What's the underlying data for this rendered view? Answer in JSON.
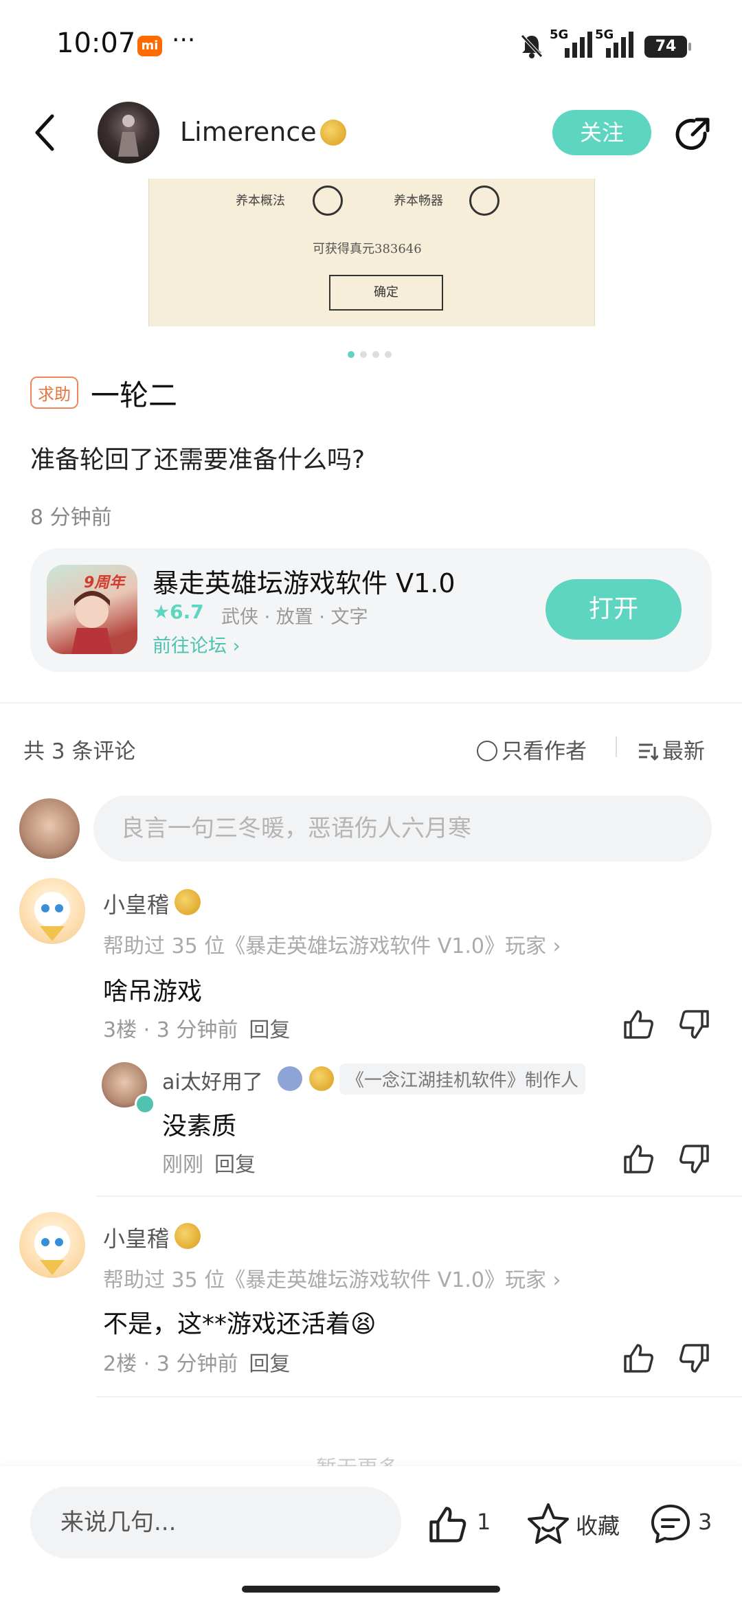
{
  "status": {
    "time": "10:07",
    "mi": "mi",
    "more": "···",
    "sig1": "5G",
    "sig2": "5G",
    "battery": "74"
  },
  "header": {
    "author": "Limerence",
    "follow": "关注"
  },
  "post_image": {
    "line1a": "养本概法",
    "line1b": "养本畅器",
    "line2": "可获得真元383646",
    "button": "确定"
  },
  "post": {
    "tag": "求助",
    "title": "一轮二",
    "body": "准备轮回了还需要准备什么吗?",
    "time": "8 分钟前"
  },
  "game": {
    "name": "暴走英雄坛游戏软件 V1.0",
    "score": "★6.7",
    "tags": "武侠 · 放置 · 文字",
    "forum": "前往论坛 ›",
    "open": "打开",
    "icon_text": "9周年"
  },
  "comments_header": {
    "count": "共 3 条评论",
    "only_author": "只看作者",
    "sort": "最新"
  },
  "comment_input": {
    "placeholder": "良言一句三冬暖，恶语伤人六月寒"
  },
  "comments": [
    {
      "name": "小皇稽",
      "sub": "帮助过 35 位《暴走英雄坛游戏软件 V1.0》玩家 ›",
      "text": "啥吊游戏",
      "floor": "3楼 · 3 分钟前",
      "reply": "回复"
    },
    {
      "name": "小皇稽",
      "sub": "帮助过 35 位《暴走英雄坛游戏软件 V1.0》玩家 ›",
      "text": "不是，这**游戏还活着😫",
      "floor": "2楼 · 3 分钟前",
      "reply": "回复"
    }
  ],
  "sub_reply": {
    "name": "ai太好用了",
    "tag": "《一念江湖挂机软件》制作人",
    "text": "没素质",
    "time": "刚刚",
    "reply": "回复"
  },
  "more_text": "暂无更多",
  "bottom": {
    "say": "来说几句...",
    "likes": "1",
    "collect": "收藏",
    "comments": "3"
  },
  "colors": {
    "accent": "#5ed5c0",
    "tag_help": "#e8743f"
  }
}
